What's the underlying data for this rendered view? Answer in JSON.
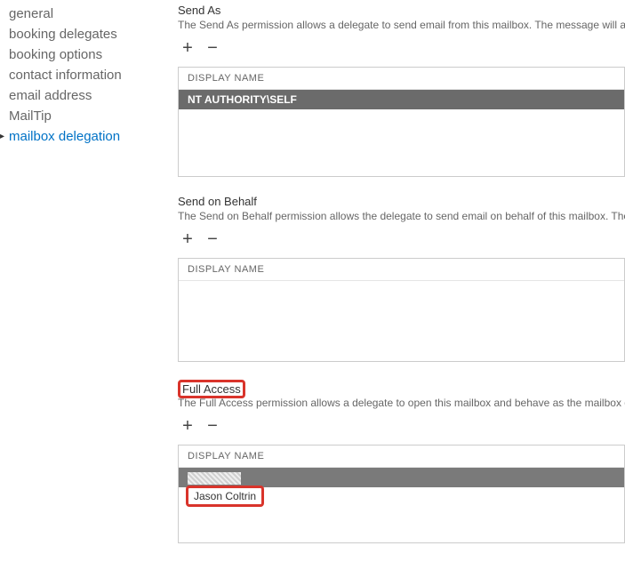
{
  "sidebar": {
    "items": [
      {
        "label": "general"
      },
      {
        "label": "booking delegates"
      },
      {
        "label": "booking options"
      },
      {
        "label": "contact information"
      },
      {
        "label": "email address"
      },
      {
        "label": "MailTip"
      },
      {
        "label": "mailbox delegation"
      }
    ],
    "active_index": 6
  },
  "sections": {
    "send_as": {
      "title": "Send As",
      "description": "The Send As permission allows a delegate to send email from this mailbox. The message will ap",
      "column_header": "DISPLAY NAME",
      "rows": [
        {
          "display_name": "NT AUTHORITY\\SELF",
          "selected": true
        }
      ]
    },
    "send_on_behalf": {
      "title": "Send on Behalf",
      "description": "The Send on Behalf permission allows the delegate to send email on behalf of this mailbox. The",
      "column_header": "DISPLAY NAME",
      "rows": []
    },
    "full_access": {
      "title": "Full Access",
      "description": "The Full Access permission allows a delegate to open this mailbox and behave as the mailbox o",
      "column_header": "DISPLAY NAME",
      "rows": [
        {
          "display_name": "",
          "selected": true,
          "redacted": true
        },
        {
          "display_name": "Jason Coltrin",
          "selected": false
        }
      ]
    }
  },
  "icons": {
    "plus": "+",
    "minus": "−"
  }
}
